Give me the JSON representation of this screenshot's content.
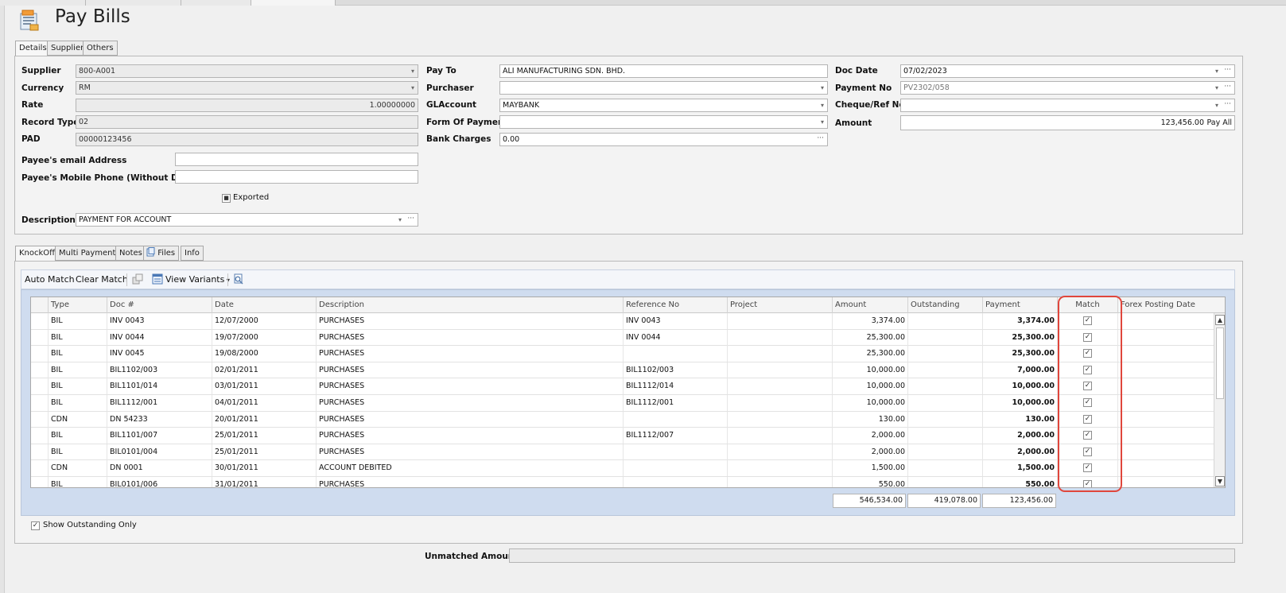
{
  "title": "Pay Bills",
  "header_tabs": [
    {
      "label": "Details",
      "active": true
    },
    {
      "label": "Supplier",
      "active": false
    },
    {
      "label": "Others",
      "active": false
    }
  ],
  "details": {
    "supplier": {
      "label": "Supplier",
      "value": "800-A001"
    },
    "currency": {
      "label": "Currency",
      "value": "RM"
    },
    "rate": {
      "label": "Rate",
      "value": "1.00000000"
    },
    "record_type": {
      "label": "Record Type",
      "value": "02"
    },
    "pad": {
      "label": "PAD",
      "value": "00000123456"
    },
    "payee_email": {
      "label": "Payee's email Address",
      "value": ""
    },
    "payee_mobile": {
      "label": "Payee's Mobile Phone (Without Dash)",
      "value": ""
    },
    "exported": {
      "label": "Exported",
      "checked": false
    },
    "description": {
      "label": "Description",
      "value": "PAYMENT FOR ACCOUNT"
    },
    "pay_to": {
      "label": "Pay To",
      "value": "ALI MANUFACTURING SDN. BHD."
    },
    "purchaser": {
      "label": "Purchaser",
      "value": ""
    },
    "gl_account": {
      "label": "GLAccount",
      "value": "MAYBANK"
    },
    "form_of_payment": {
      "label": "Form Of Payment",
      "value": ""
    },
    "bank_charges": {
      "label": "Bank Charges",
      "value": "0.00"
    },
    "doc_date": {
      "label": "Doc Date",
      "value": "07/02/2023"
    },
    "payment_no": {
      "label": "Payment No",
      "value": "PV2302/058"
    },
    "cheque_ref": {
      "label": "Cheque/Ref No.",
      "value": ""
    },
    "amount": {
      "label": "Amount",
      "value": "123,456.00"
    },
    "pay_all_label": "Pay All"
  },
  "bottom_tabs": [
    {
      "label": "KnockOff",
      "active": true
    },
    {
      "label": "Multi Payments",
      "active": false
    },
    {
      "label": "Notes",
      "active": false
    },
    {
      "label": "Files",
      "active": false
    },
    {
      "label": "Info",
      "active": false
    }
  ],
  "toolbar": {
    "auto_match": "Auto Match",
    "clear_match": "Clear Match",
    "view_variants": "View Variants"
  },
  "grid": {
    "columns": [
      "Type",
      "Doc #",
      "Date",
      "Description",
      "Reference No",
      "Project",
      "Amount",
      "Outstanding",
      "Payment",
      "Match",
      "Forex Posting Date"
    ],
    "rows": [
      {
        "type": "BIL",
        "doc": "INV 0043",
        "date": "12/07/2000",
        "desc": "PURCHASES",
        "ref": "INV 0043",
        "project": "",
        "amount": "3,374.00",
        "outstanding": "",
        "payment": "3,374.00",
        "match": true
      },
      {
        "type": "BIL",
        "doc": "INV 0044",
        "date": "19/07/2000",
        "desc": "PURCHASES",
        "ref": "INV 0044",
        "project": "",
        "amount": "25,300.00",
        "outstanding": "",
        "payment": "25,300.00",
        "match": true
      },
      {
        "type": "BIL",
        "doc": "INV 0045",
        "date": "19/08/2000",
        "desc": "PURCHASES",
        "ref": "",
        "project": "",
        "amount": "25,300.00",
        "outstanding": "",
        "payment": "25,300.00",
        "match": true
      },
      {
        "type": "BIL",
        "doc": "BIL1102/003",
        "date": "02/01/2011",
        "desc": "PURCHASES",
        "ref": "BIL1102/003",
        "project": "",
        "amount": "10,000.00",
        "outstanding": "",
        "payment": "7,000.00",
        "match": true
      },
      {
        "type": "BIL",
        "doc": "BIL1101/014",
        "date": "03/01/2011",
        "desc": "PURCHASES",
        "ref": "BIL1112/014",
        "project": "",
        "amount": "10,000.00",
        "outstanding": "",
        "payment": "10,000.00",
        "match": true
      },
      {
        "type": "BIL",
        "doc": "BIL1112/001",
        "date": "04/01/2011",
        "desc": "PURCHASES",
        "ref": "BIL1112/001",
        "project": "",
        "amount": "10,000.00",
        "outstanding": "",
        "payment": "10,000.00",
        "match": true
      },
      {
        "type": "CDN",
        "doc": "DN 54233",
        "date": "20/01/2011",
        "desc": "PURCHASES",
        "ref": "",
        "project": "",
        "amount": "130.00",
        "outstanding": "",
        "payment": "130.00",
        "match": true
      },
      {
        "type": "BIL",
        "doc": "BIL1101/007",
        "date": "25/01/2011",
        "desc": "PURCHASES",
        "ref": "BIL1112/007",
        "project": "",
        "amount": "2,000.00",
        "outstanding": "",
        "payment": "2,000.00",
        "match": true
      },
      {
        "type": "BIL",
        "doc": "BIL0101/004",
        "date": "25/01/2011",
        "desc": "PURCHASES",
        "ref": "",
        "project": "",
        "amount": "2,000.00",
        "outstanding": "",
        "payment": "2,000.00",
        "match": true
      },
      {
        "type": "CDN",
        "doc": "DN 0001",
        "date": "30/01/2011",
        "desc": "ACCOUNT DEBITED",
        "ref": "",
        "project": "",
        "amount": "1,500.00",
        "outstanding": "",
        "payment": "1,500.00",
        "match": true
      },
      {
        "type": "BIL",
        "doc": "BIL0101/006",
        "date": "31/01/2011",
        "desc": "PURCHASES",
        "ref": "",
        "project": "",
        "amount": "550.00",
        "outstanding": "",
        "payment": "550.00",
        "match": true
      }
    ],
    "totals": {
      "amount": "546,534.00",
      "outstanding": "419,078.00",
      "payment": "123,456.00"
    }
  },
  "show_outstanding_only": {
    "label": "Show Outstanding Only",
    "checked": true
  },
  "unmatched_amount": {
    "label": "Unmatched Amount",
    "value": ""
  },
  "colors": {
    "highlight": "#e0463c",
    "grid_frame": "#cfdcef"
  }
}
